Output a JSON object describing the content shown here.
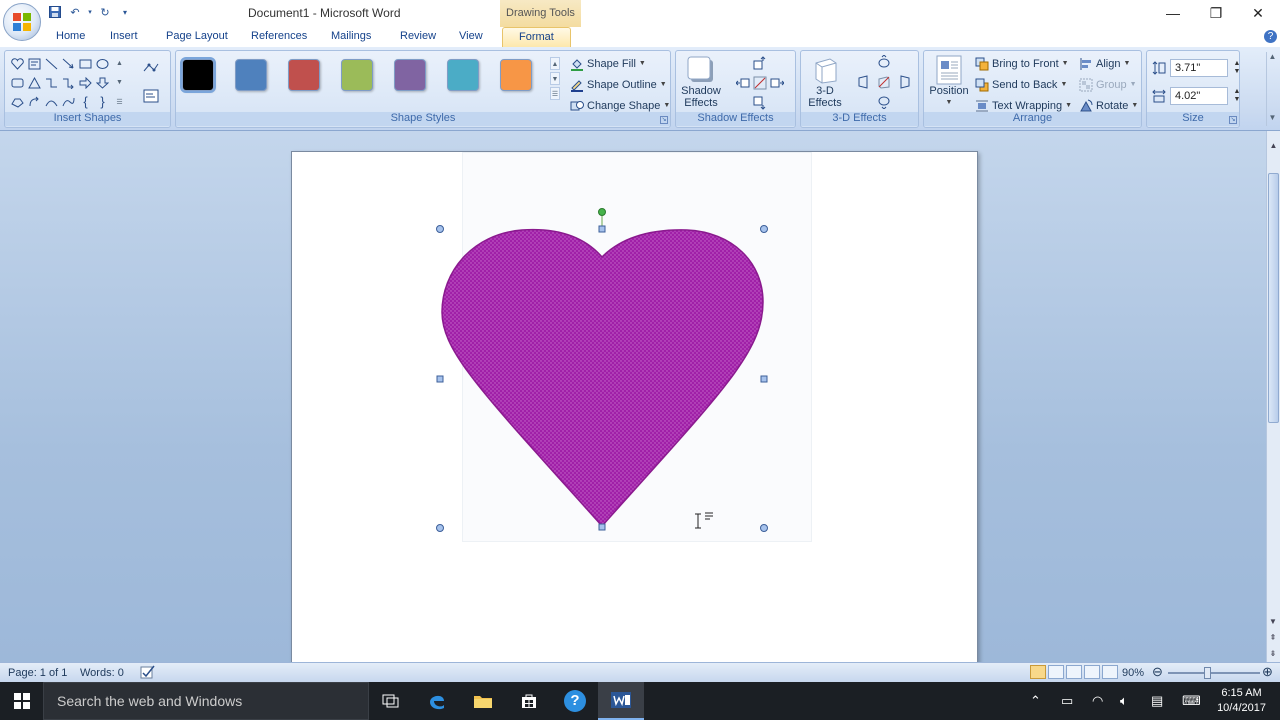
{
  "window": {
    "title": "Document1 - Microsoft Word",
    "context_tab_group": "Drawing Tools"
  },
  "tabs": [
    "Home",
    "Insert",
    "Page Layout",
    "References",
    "Mailings",
    "Review",
    "View",
    "Format"
  ],
  "active_tab": "Format",
  "ribbon": {
    "insert_shapes": {
      "label": "Insert Shapes"
    },
    "shape_styles": {
      "label": "Shape Styles",
      "swatches": [
        "#000000",
        "#4f81bd",
        "#c0504d",
        "#9bbb59",
        "#8064a2",
        "#4bacc6",
        "#f79646"
      ],
      "shape_fill": "Shape Fill",
      "shape_outline": "Shape Outline",
      "change_shape": "Change Shape"
    },
    "shadow_effects": {
      "label": "Shadow Effects",
      "button_line1": "Shadow",
      "button_line2": "Effects"
    },
    "three_d_effects": {
      "label": "3-D Effects",
      "button_line1": "3-D",
      "button_line2": "Effects"
    },
    "arrange": {
      "label": "Arrange",
      "position": "Position",
      "bring_to_front": "Bring to Front",
      "send_to_back": "Send to Back",
      "text_wrapping": "Text Wrapping",
      "align": "Align",
      "group": "Group",
      "rotate": "Rotate"
    },
    "size": {
      "label": "Size",
      "height": "3.71\"",
      "width": "4.02\""
    }
  },
  "document": {
    "shape": "heart",
    "shape_fill_color": "#a020a8"
  },
  "status_bar": {
    "page": "Page: 1 of 1",
    "words": "Words: 0",
    "zoom": "90%"
  },
  "taskbar": {
    "search_placeholder": "Search the web and Windows",
    "time": "6:15 AM",
    "date": "10/4/2017"
  }
}
